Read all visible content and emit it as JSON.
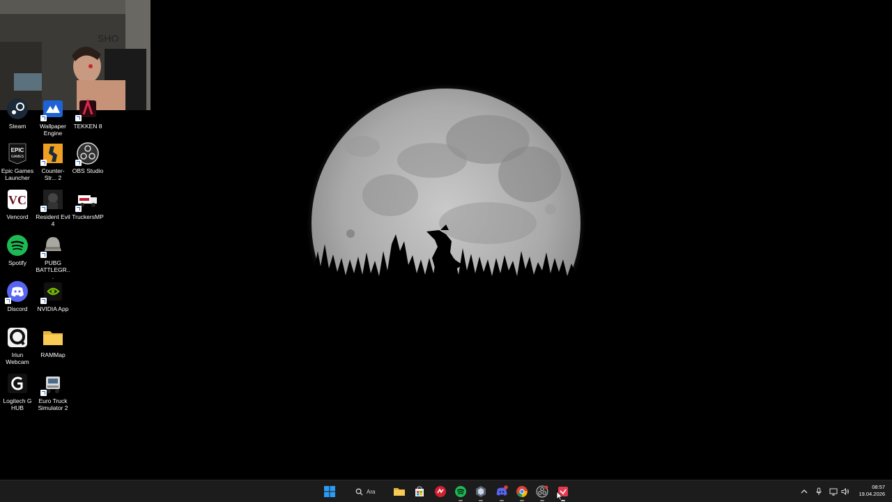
{
  "desktop": {
    "icons": [
      {
        "label": "Steam",
        "icon": "steam-icon"
      },
      {
        "label": "Wallpaper Engine",
        "icon": "wallpaper-engine-icon"
      },
      {
        "label": "TEKKEN 8",
        "icon": "tekken-icon"
      },
      {
        "label": "Epic Games Launcher",
        "icon": "epic-games-icon"
      },
      {
        "label": "Counter-Str... 2",
        "icon": "counter-strike-icon"
      },
      {
        "label": "OBS Studio",
        "icon": "obs-icon"
      },
      {
        "label": "Vencord",
        "icon": "vencord-icon"
      },
      {
        "label": "Resident Evil 4",
        "icon": "resident-evil-icon"
      },
      {
        "label": "TruckersMP",
        "icon": "truckersmp-icon"
      },
      {
        "label": "Spotify",
        "icon": "spotify-icon"
      },
      {
        "label": "PUBG BATTLEGR...",
        "icon": "pubg-icon"
      },
      {
        "label": "Discord",
        "icon": "discord-icon"
      },
      {
        "label": "NVIDIA App",
        "icon": "nvidia-icon"
      },
      {
        "label": "Iriun Webcam",
        "icon": "iriun-icon"
      },
      {
        "label": "RAMMap",
        "icon": "folder-icon"
      },
      {
        "label": "Logitech G HUB",
        "icon": "logitech-icon"
      },
      {
        "label": "Euro Truck Simulator 2",
        "icon": "euro-truck-icon"
      }
    ],
    "epic_logo_text": "EPIC GAMES"
  },
  "taskbar": {
    "search_label": "Ara",
    "apps": [
      "start-icon",
      "search-icon",
      "file-explorer-icon",
      "microsoft-store-icon",
      "app-red-icon",
      "spotify-icon",
      "app-grey-icon",
      "discord-icon",
      "chrome-icon",
      "obs-icon",
      "app-active-icon"
    ],
    "time": "08:57",
    "date": "19.04.2026"
  },
  "colors": {
    "taskbar_bg": "#1c1c1c",
    "spotify": "#1db954",
    "discord": "#5865f2",
    "windows_blue": "#0a84ff"
  }
}
